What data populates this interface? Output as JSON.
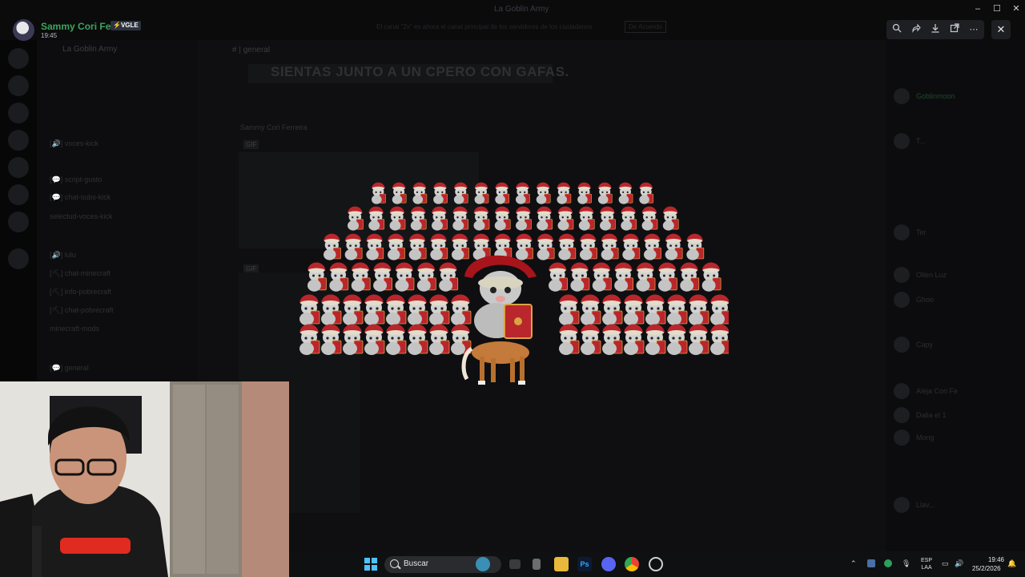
{
  "window": {
    "title": "La Goblin Army"
  },
  "viewer": {
    "author_name": "Sammy Cori Fer...",
    "author_tag": "⚡VGLE",
    "timestamp": "19:45",
    "notice_text": "El canal \"2x\" es ahora el canal principal de los servidores de los ciudadanos",
    "notice_button": "De Acuerdo",
    "toolbar_icons": [
      "zoom-icon",
      "forward-icon",
      "download-icon",
      "open-external-icon",
      "more-icon"
    ],
    "close_icon": "close-icon"
  },
  "background": {
    "server_name": "La Goblin Army",
    "chat_title": "# | general",
    "banner": "SIENTAS JUNTO A UN CPERO CON GAFAS.",
    "message_author": "Sammy Cori Ferreira",
    "gif_label": "GIF",
    "channels": [
      "[🔊] voces-kick",
      "[💬] script-gusto",
      "[💬] chat-subs-kick",
      "selectud-voces-kick",
      "[🔊] lulu",
      "[⛏] chat-minecraft",
      "[⛏] info-pobrecraft",
      "[⛏] chat-pobrecraft",
      "minecraft-mods",
      "[💬] general"
    ],
    "members": [
      "Goblinmoon",
      "T...",
      "Ter",
      "Ollen Luz",
      "Ghoo",
      "Capy",
      "Aleja Cori Fe",
      "Dalia el 1",
      "Mong",
      "Llav..."
    ]
  },
  "taskbar": {
    "search_label": "Buscar",
    "lang_line1": "ESP",
    "lang_line2": "LAA",
    "time": "19:46",
    "date": "25/2/2026"
  },
  "colors": {
    "author_name": "#3ba55d",
    "accent_red": "#b9262c",
    "viewer_bg": "#000000"
  }
}
